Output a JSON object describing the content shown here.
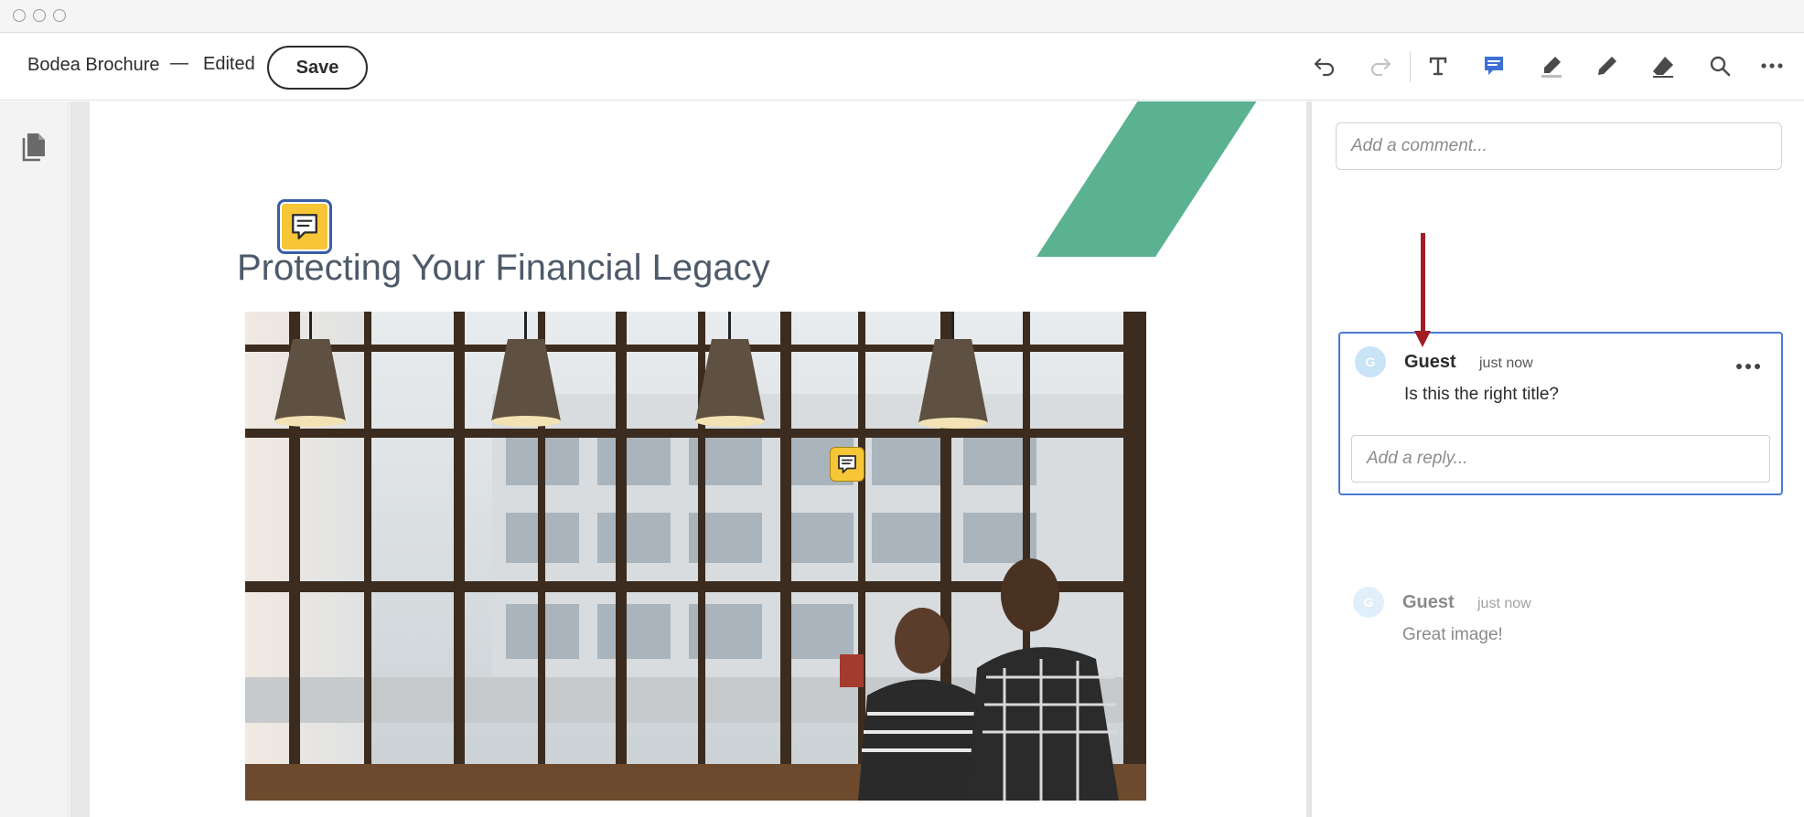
{
  "window": {
    "traffic_lights": [
      "close",
      "minimize",
      "zoom"
    ]
  },
  "toolbar": {
    "doc_name": "Bodea Brochure",
    "separator": "—",
    "status": "Edited",
    "save_label": "Save",
    "tools": [
      {
        "name": "undo-icon"
      },
      {
        "name": "redo-icon"
      },
      {
        "name": "add-text-icon"
      },
      {
        "name": "comment-icon",
        "active": true
      },
      {
        "name": "highlight-icon"
      },
      {
        "name": "draw-pencil-icon"
      },
      {
        "name": "eraser-icon"
      },
      {
        "name": "search-icon"
      },
      {
        "name": "more-options-icon"
      }
    ],
    "active_color": "#3d70d4"
  },
  "sidebar": {
    "icon": "document-pages-icon"
  },
  "document": {
    "title": "Protecting Your Financial Legacy",
    "accent_color": "#5bb291",
    "title_color": "#4e5a6a",
    "note_color": "#f6c636"
  },
  "comments_panel": {
    "add_comment_placeholder": "Add a comment...",
    "comments": [
      {
        "avatar_initial": "G",
        "author": "Guest",
        "time": "just now",
        "text": "Is this the right title?",
        "reply_placeholder": "Add a reply...",
        "selected": true
      },
      {
        "avatar_initial": "G",
        "author": "Guest",
        "time": "just now",
        "text": "Great image!",
        "selected": false
      }
    ],
    "selected_border_color": "#4a7ad1",
    "annotation_arrow_color": "#a11d23"
  }
}
